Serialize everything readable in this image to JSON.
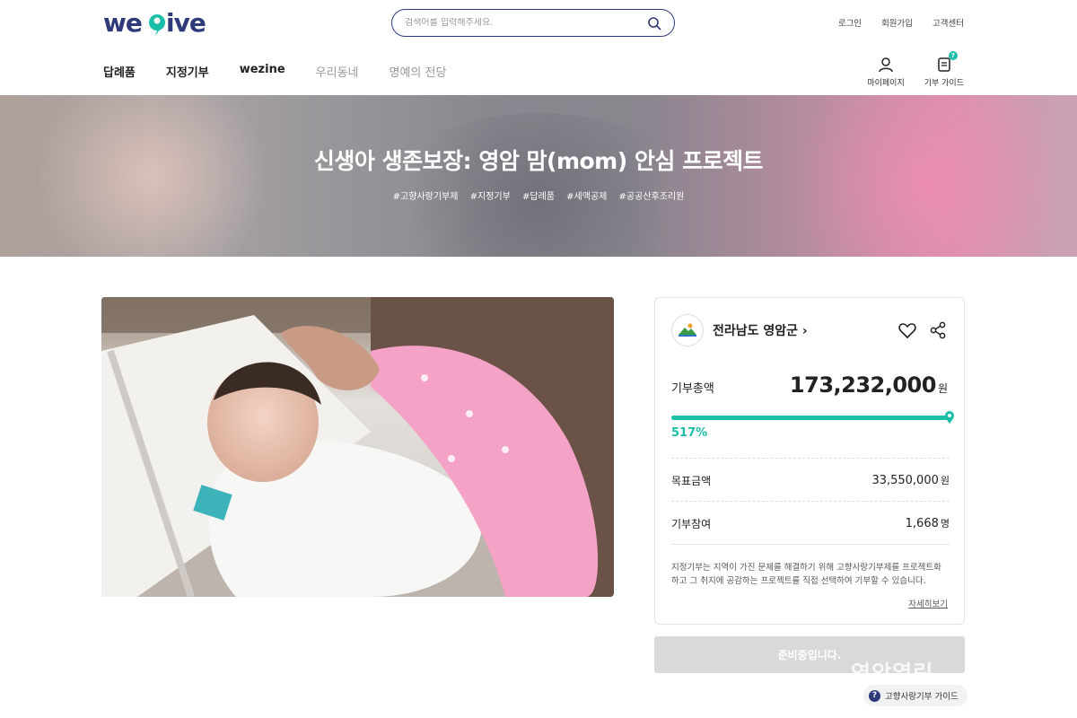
{
  "header": {
    "logo_text": "wegive",
    "search_placeholder": "검색어를 입력해주세요.",
    "util_links": [
      "로그인",
      "회원가입",
      "고객센터"
    ]
  },
  "nav": {
    "items": [
      "답례품",
      "지정기부",
      "wezine",
      "우리동네",
      "명예의 전당"
    ]
  },
  "quick": {
    "mypage": "마이페이지",
    "guide": "기부 가이드",
    "guide_badge": "?"
  },
  "hero": {
    "title": "신생아 생존보장: 영암 맘(mom) 안심 프로젝트",
    "tags": [
      "#고향사랑기부제",
      "#지정기부",
      "#답례품",
      "#세액공제",
      "#공공산후조리원"
    ]
  },
  "project": {
    "org_name": "전라남도 영암군 ›",
    "total_label": "기부총액",
    "total_value": "173,232,000",
    "currency": "원",
    "progress_percent_text": "517%",
    "progress_fraction": 1.0,
    "goal_label": "목표금액",
    "goal_value": "33,550,000",
    "participants_label": "기부참여",
    "participants_value": "1,668",
    "participants_unit": "명",
    "description": "지정기부는 지역이 가진 문제를 해결하기 위해 고향사랑기부제를 프로젝트화 하고 그 취지에 공감하는 프로젝트를 직접 선택하여 기부할 수 있습니다.",
    "more_link": "자세히보기",
    "cta_label": "준비중입니다."
  },
  "watermark": "영암열린",
  "floating_guide": "고향사랑기부 가이드",
  "colors": {
    "brand_navy": "#2e3a7a",
    "accent_teal": "#1bbfa7"
  }
}
